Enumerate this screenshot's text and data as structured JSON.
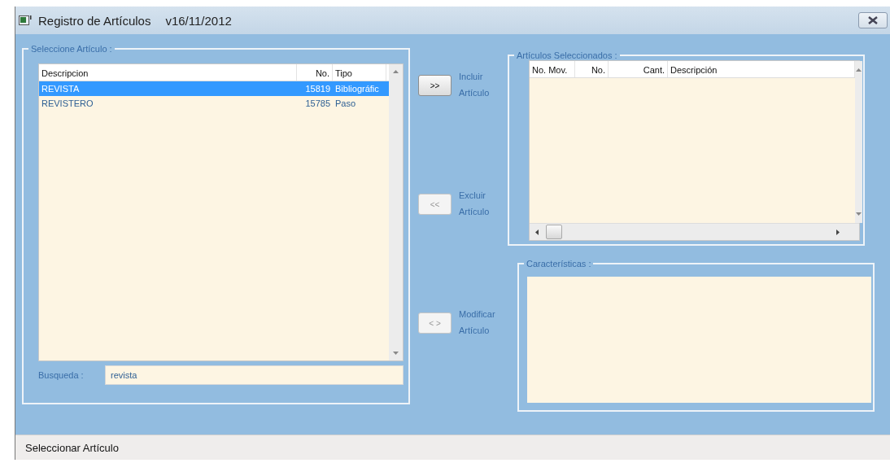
{
  "window": {
    "title": "Registro de Artículos",
    "version": "v16/11/2012"
  },
  "select_group": {
    "legend": "Seleccione Artículo :",
    "columns": [
      "Descripcion",
      "No.",
      "Tipo"
    ],
    "rows": [
      {
        "cells": [
          "REVISTA",
          "15819",
          "Bibliográfic"
        ],
        "selected": true
      },
      {
        "cells": [
          "REVISTERO",
          "15785",
          "Paso"
        ],
        "selected": false
      }
    ],
    "search": {
      "label": "Busqueda :",
      "value": "revista"
    }
  },
  "actions": [
    {
      "symbol": ">>",
      "label_lines": [
        "Incluir",
        "Artículo"
      ],
      "disabled": false
    },
    {
      "symbol": "<<",
      "label_lines": [
        "Excluir",
        "Artículo"
      ],
      "disabled": true
    },
    {
      "symbol": "< >",
      "label_lines": [
        "Modificar",
        "Artículo"
      ],
      "disabled": true
    }
  ],
  "selected_group": {
    "legend": "Artículos Seleccionados :",
    "columns": [
      "No. Mov.",
      "No.",
      "Cant.",
      "Descripción"
    ]
  },
  "features_group": {
    "legend": "Características :"
  },
  "status_bar": "Seleccionar Artículo"
}
